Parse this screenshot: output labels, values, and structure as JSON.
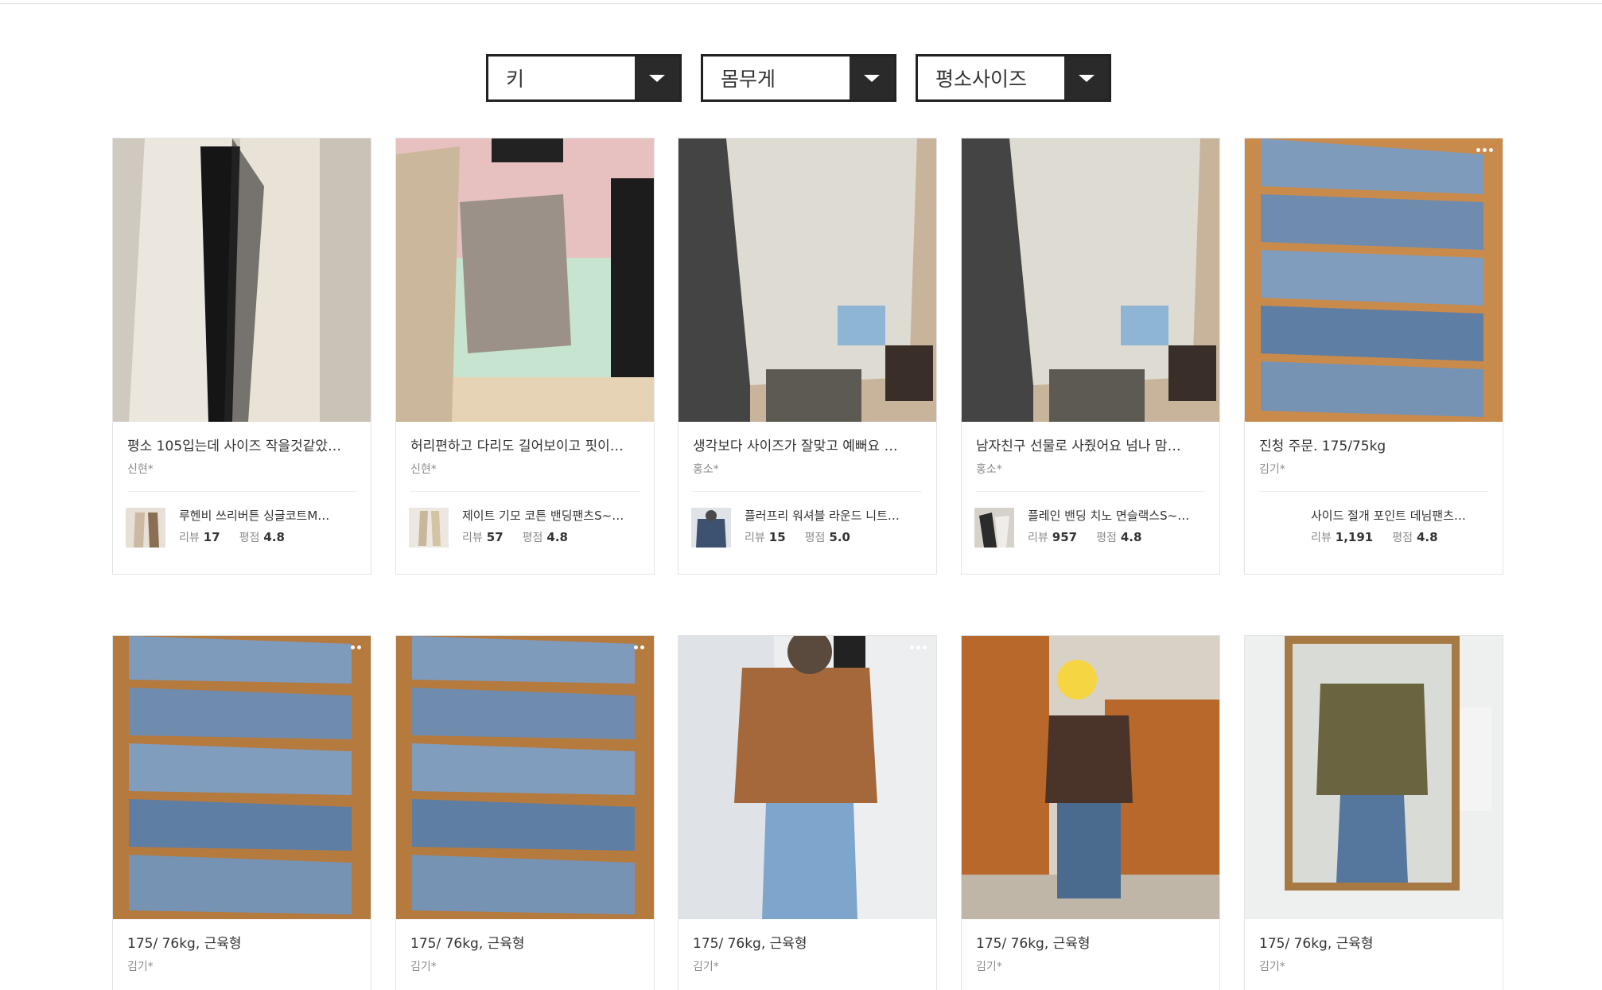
{
  "filters": {
    "height": "키",
    "weight": "몸무게",
    "size": "평소사이즈"
  },
  "labels": {
    "review": "리뷰",
    "rating": "평점"
  },
  "row1": [
    {
      "text": "평소 105입는데 사이즈 작을것같았…",
      "author": "신현*",
      "product": "루헨비 쓰리버튼 싱글코트M…",
      "reviews": "17",
      "rating": "4.8"
    },
    {
      "text": "허리편하고 다리도 길어보이고 핏이…",
      "author": "신현*",
      "product": "제이트 기모 코튼 밴딩팬츠S~…",
      "reviews": "57",
      "rating": "4.8"
    },
    {
      "text": "생각보다 사이즈가 잘맞고 예뻐요 …",
      "author": "홍소*",
      "product": "플러프리 워셔블 라운드 니트…",
      "reviews": "15",
      "rating": "5.0"
    },
    {
      "text": "남자친구 선물로 사줬어요 넘나 맘…",
      "author": "홍소*",
      "product": "플레인 밴딩 치노 면슬랙스S~…",
      "reviews": "957",
      "rating": "4.8"
    },
    {
      "text": "진청 주문. 175/75kg",
      "author": "김기*",
      "product": "사이드 절개 포인트 데님팬츠…",
      "reviews": "1,191",
      "rating": "4.8"
    }
  ],
  "row2": [
    {
      "text": "175/ 76kg, 근육형",
      "author": "김기*"
    },
    {
      "text": "175/ 76kg, 근육형",
      "author": "김기*"
    },
    {
      "text": "175/ 76kg, 근육형",
      "author": "김기*"
    },
    {
      "text": "175/ 76kg, 근육형",
      "author": "김기*"
    },
    {
      "text": "175/ 76kg, 근육형",
      "author": "김기*"
    }
  ]
}
